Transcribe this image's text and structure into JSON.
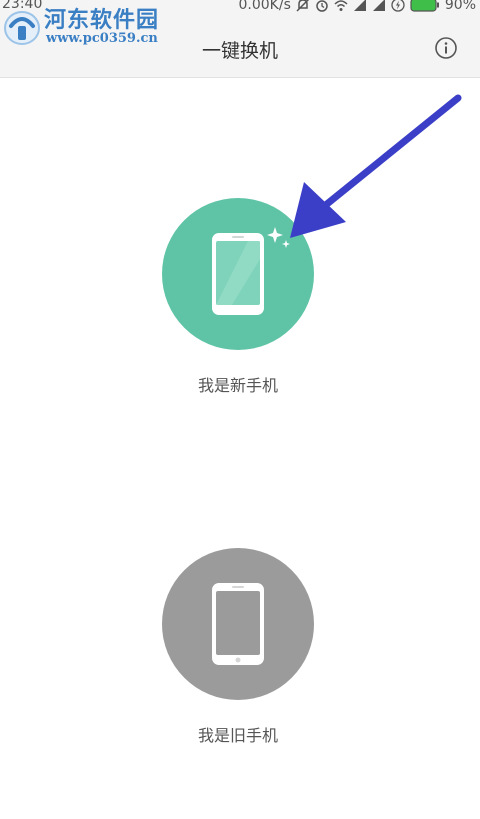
{
  "status_bar": {
    "time": "23:40",
    "network_speed": "0.00K/s",
    "battery": "90%",
    "icons": [
      "alarm-off-icon",
      "alarm-icon",
      "wifi-icon",
      "signal-icon",
      "signal-icon",
      "charging-icon",
      "battery-icon"
    ]
  },
  "watermark": {
    "title": "河东软件园",
    "url": "www.pc0359.cn"
  },
  "header": {
    "title": "一键换机",
    "info_icon": "info-icon"
  },
  "options": {
    "new_phone": {
      "label": "我是新手机",
      "icon": "phone-icon",
      "color": "#5fc4a6"
    },
    "old_phone": {
      "label": "我是旧手机",
      "icon": "phone-icon",
      "color": "#9b9b9b"
    }
  },
  "annotation": {
    "icon": "arrow-icon",
    "color": "#3b3fc7"
  }
}
